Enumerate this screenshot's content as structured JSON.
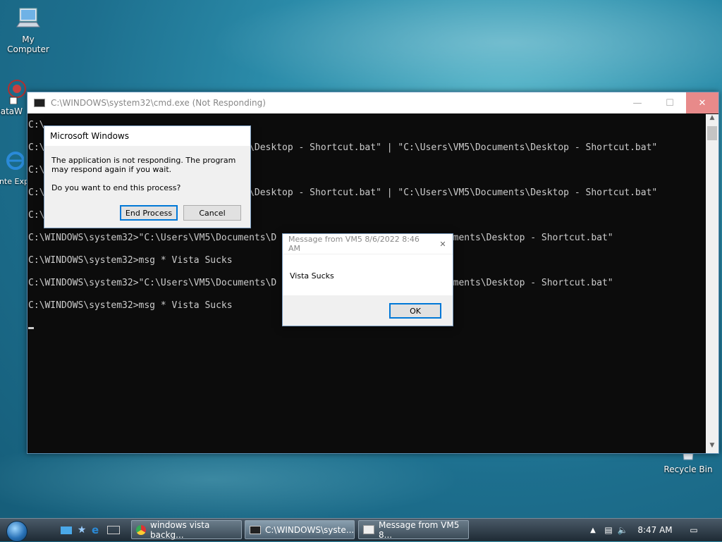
{
  "desktop": {
    "icons": [
      {
        "label": "My Computer"
      },
      {
        "label": "DataW"
      },
      {
        "label": "Inte Expl"
      },
      {
        "label": "Recycle Bin"
      }
    ]
  },
  "cmd": {
    "title": "C:\\WINDOWS\\system32\\cmd.exe (Not Responding)",
    "minimize": "—",
    "maximize": "☐",
    "close": "✕",
    "lines": [
      "C:\\",
      "C:\\                                 ents\\Desktop - Shortcut.bat\" | \"C:\\Users\\VM5\\Documents\\Desktop - Shortcut.bat\"",
      "C:\\",
      "C:\\                                 ents\\Desktop - Shortcut.bat\" | \"C:\\Users\\VM5\\Documents\\Desktop - Shortcut.bat\"",
      "C:\\",
      "C:\\WINDOWS\\system32>\"C:\\Users\\VM5\\Documents\\D                   sers\\VM5\\Documents\\Desktop - Shortcut.bat\"",
      "C:\\WINDOWS\\system32>msg * Vista Sucks",
      "C:\\WINDOWS\\system32>\"C:\\Users\\VM5\\Documents\\D                   sers\\VM5\\Documents\\Desktop - Shortcut.bat\"",
      "C:\\WINDOWS\\system32>msg * Vista Sucks"
    ]
  },
  "not_responding_dialog": {
    "title": "Microsoft Windows",
    "message": "The application is not responding. The program may respond again if you wait.",
    "question": "Do you want to end this process?",
    "end_label": "End Process",
    "cancel_label": "Cancel"
  },
  "msg_dialog": {
    "title": "Message from VM5 8/6/2022 8:46 AM",
    "close": "✕",
    "body": "Vista Sucks",
    "ok_label": "OK"
  },
  "taskbar": {
    "tasks": [
      {
        "label": "windows vista backg..."
      },
      {
        "label": "C:\\WINDOWS\\syste..."
      },
      {
        "label": "Message from VM5 8..."
      }
    ],
    "clock": "8:47 AM"
  }
}
